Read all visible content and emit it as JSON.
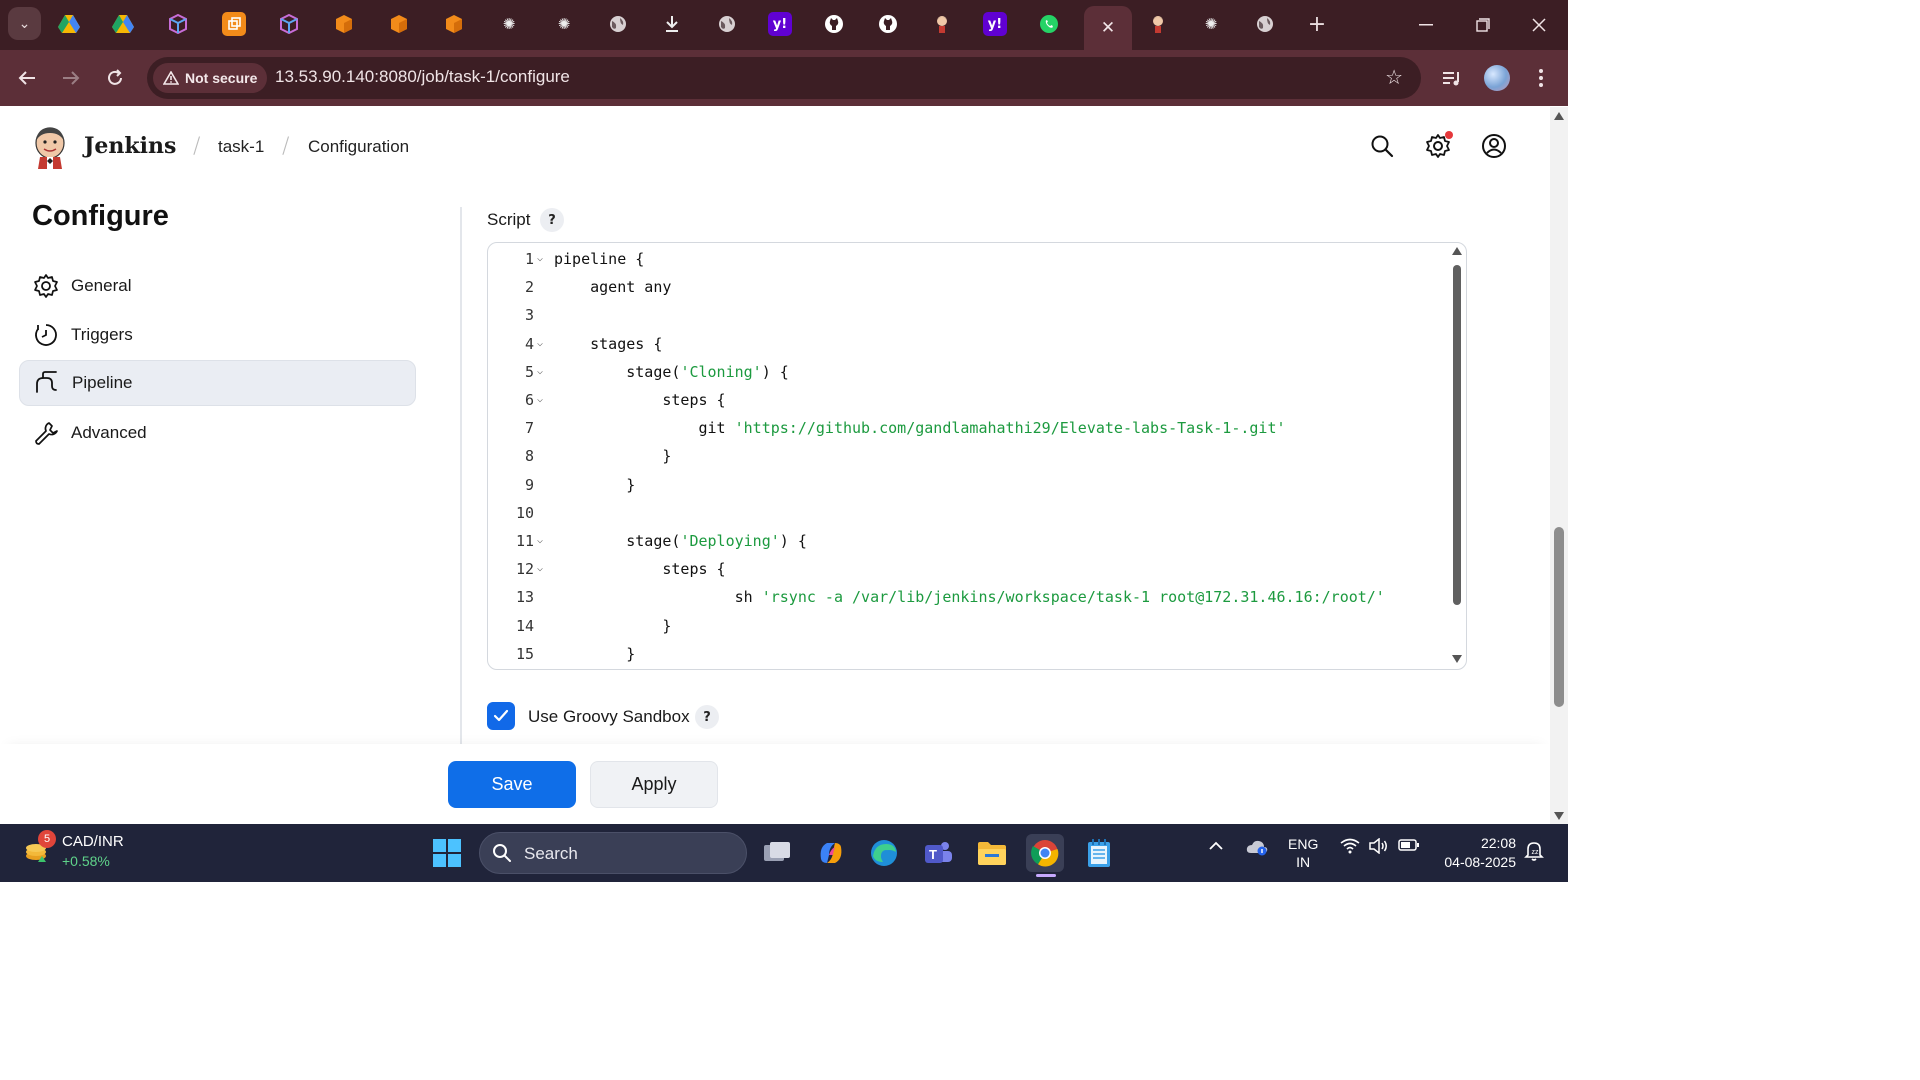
{
  "browser": {
    "active_tab_close": "✕",
    "security_chip": "Not secure",
    "url": "13.53.90.140:8080/job/task-1/configure"
  },
  "jenkins": {
    "brand": "Jenkins",
    "breadcrumbs": [
      "task-1",
      "Configuration"
    ]
  },
  "sidebar": {
    "title": "Configure",
    "items": [
      {
        "label": "General",
        "icon": "gear-icon"
      },
      {
        "label": "Triggers",
        "icon": "clock-icon"
      },
      {
        "label": "Pipeline",
        "icon": "pipeline-icon",
        "active": true
      },
      {
        "label": "Advanced",
        "icon": "wrench-icon"
      }
    ]
  },
  "script": {
    "label": "Script",
    "help": "?",
    "lines": [
      {
        "n": "1",
        "fold": true,
        "indent": "",
        "code": "pipeline {",
        "str": ""
      },
      {
        "n": "2",
        "fold": false,
        "indent": "    ",
        "code": "agent any",
        "str": ""
      },
      {
        "n": "3",
        "fold": false,
        "indent": "",
        "code": "",
        "str": ""
      },
      {
        "n": "4",
        "fold": true,
        "indent": "    ",
        "code": "stages {",
        "str": ""
      },
      {
        "n": "5",
        "fold": true,
        "indent": "        ",
        "code": "stage(",
        "str": "'Cloning'",
        "after": ") {"
      },
      {
        "n": "6",
        "fold": true,
        "indent": "            ",
        "code": "steps {",
        "str": ""
      },
      {
        "n": "7",
        "fold": false,
        "indent": "                ",
        "code": "git ",
        "str": "'https://github.com/gandlamahathi29/Elevate-labs-Task-1-.git'",
        "after": ""
      },
      {
        "n": "8",
        "fold": false,
        "indent": "            ",
        "code": "}",
        "str": ""
      },
      {
        "n": "9",
        "fold": false,
        "indent": "        ",
        "code": "}",
        "str": ""
      },
      {
        "n": "10",
        "fold": false,
        "indent": "",
        "code": "",
        "str": ""
      },
      {
        "n": "11",
        "fold": true,
        "indent": "        ",
        "code": "stage(",
        "str": "'Deploying'",
        "after": ") {"
      },
      {
        "n": "12",
        "fold": true,
        "indent": "            ",
        "code": "steps {",
        "str": ""
      },
      {
        "n": "13",
        "fold": false,
        "indent": "                    ",
        "code": "sh ",
        "str": "'rsync -a /var/lib/jenkins/workspace/task-1 root@172.31.46.16:/root/'",
        "after": ""
      },
      {
        "n": "14",
        "fold": false,
        "indent": "            ",
        "code": "}",
        "str": ""
      },
      {
        "n": "15",
        "fold": false,
        "indent": "        ",
        "code": "}",
        "str": ""
      }
    ]
  },
  "sandbox": {
    "label": "Use Groovy Sandbox",
    "checked": true,
    "help": "?"
  },
  "buttons": {
    "save": "Save",
    "apply": "Apply"
  },
  "taskbar": {
    "widget_badge": "5",
    "ticker_name": "CAD/INR",
    "ticker_change": "+0.58%",
    "search_label": "Search",
    "lang_line1": "ENG",
    "lang_line2": "IN",
    "time": "22:08",
    "date": "04-08-2025"
  },
  "colors": {
    "accent": "#0f6ee8",
    "string": "#1c9a3f",
    "chrome": "#5c2f38"
  }
}
